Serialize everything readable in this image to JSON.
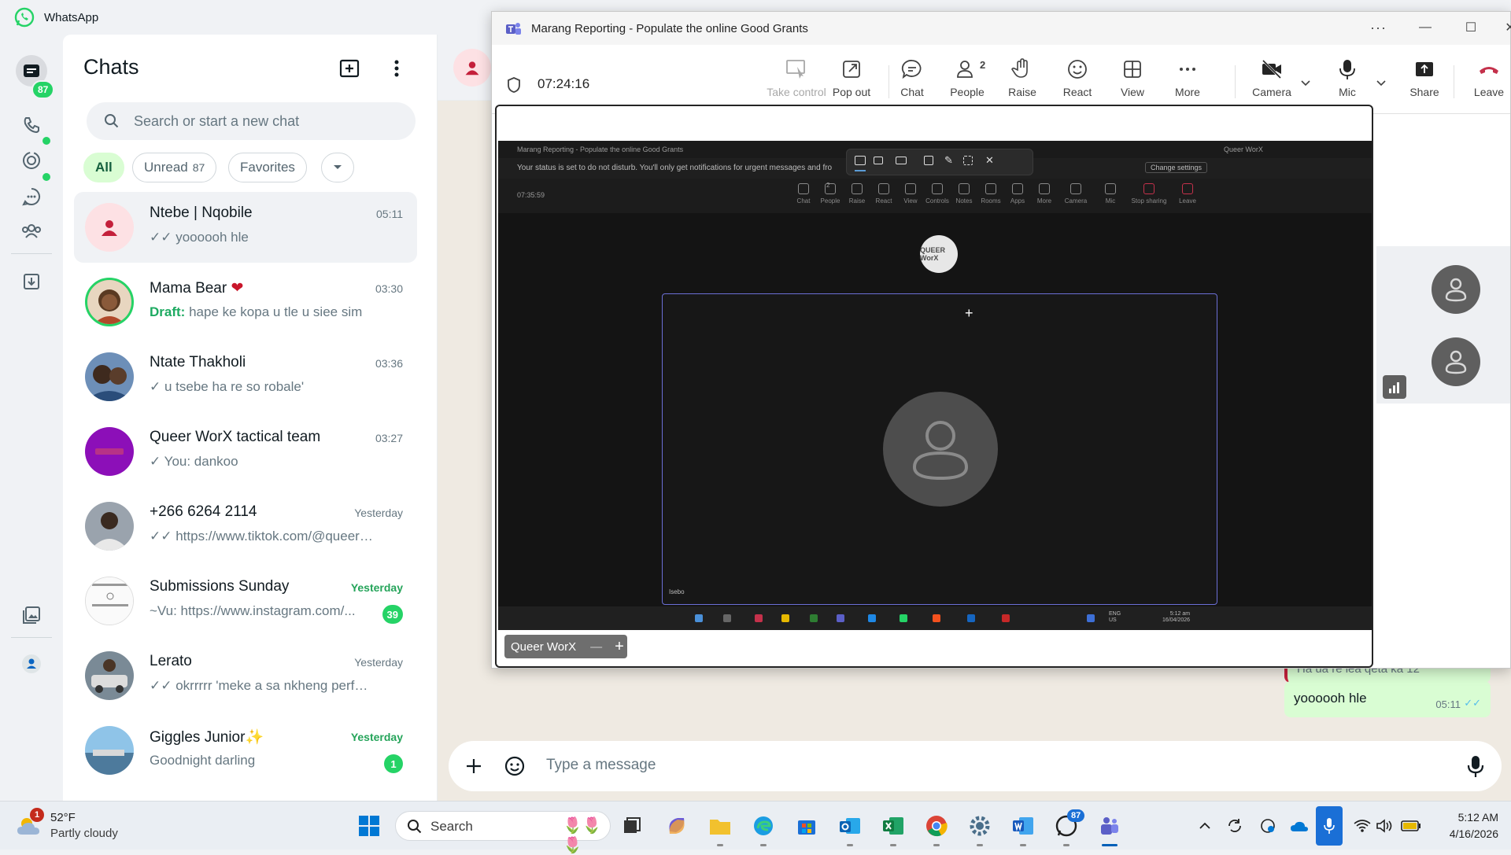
{
  "whatsapp": {
    "app_title": "WhatsApp",
    "rail": {
      "chats_badge": "87"
    },
    "chatlist": {
      "title": "Chats",
      "search_placeholder": "Search or start a new chat",
      "filters": [
        {
          "label": "All",
          "count": ""
        },
        {
          "label": "Unread",
          "count": "87"
        },
        {
          "label": "Favorites",
          "count": ""
        }
      ],
      "chats": [
        {
          "name": "Ntebe | Nqobile",
          "time": "05:11",
          "preview": "yoooooh hle",
          "status": "read",
          "draft_label": "",
          "unread": ""
        },
        {
          "name": "Mama Bear",
          "time": "03:30",
          "preview": "hape ke kopa u tle u siee sim",
          "status": "",
          "draft_label": "Draft:",
          "unread": ""
        },
        {
          "name": "Ntate Thakholi",
          "time": "03:36",
          "preview": "u tsebe ha re so robale'",
          "status": "sent",
          "draft_label": "",
          "unread": ""
        },
        {
          "name": "Queer WorX tactical team",
          "time": "03:27",
          "preview": "You: dankoo",
          "status": "sent",
          "draft_label": "",
          "unread": ""
        },
        {
          "name": "+266 6264 2114",
          "time": "Yesterday",
          "preview": "https://www.tiktok.com/@queer_w...",
          "status": "read",
          "draft_label": "",
          "unread": ""
        },
        {
          "name": "Submissions Sunday",
          "time": "Yesterday",
          "preview": "~Vu: https://www.instagram.com/...",
          "status": "",
          "draft_label": "",
          "unread": "39"
        },
        {
          "name": "Lerato",
          "time": "Yesterday",
          "preview": "okrrrrr 'meke a sa nkheng perfume",
          "status": "read",
          "draft_label": "",
          "unread": ""
        },
        {
          "name": "Giggles Junior",
          "time": "Yesterday",
          "preview": "Goodnight darling",
          "status": "",
          "draft_label": "",
          "unread": "1"
        }
      ]
    },
    "conversation": {
      "partial_bubble_text": "Ha ua re lea qeta ka 12",
      "last_message": "yoooooh hle",
      "last_message_time": "05:11",
      "compose_placeholder": "Type a message"
    }
  },
  "teams": {
    "window_title": "Marang Reporting - Populate the online Good Grants",
    "timer": "07:24:16",
    "toolbar": [
      {
        "label": "Take control",
        "icon": "take-control-icon"
      },
      {
        "label": "Pop out",
        "icon": "pop-out-icon"
      },
      {
        "label": "Chat",
        "icon": "chat-icon"
      },
      {
        "label": "People",
        "icon": "people-icon",
        "count": "2"
      },
      {
        "label": "Raise",
        "icon": "raise-hand-icon"
      },
      {
        "label": "React",
        "icon": "react-icon"
      },
      {
        "label": "View",
        "icon": "view-icon"
      },
      {
        "label": "More",
        "icon": "more-icon"
      },
      {
        "label": "Camera",
        "icon": "camera-off-icon"
      },
      {
        "label": "Mic",
        "icon": "mic-icon"
      },
      {
        "label": "Share",
        "icon": "share-icon"
      },
      {
        "label": "Leave",
        "icon": "leave-icon"
      }
    ],
    "shared_screen": {
      "title": "Marang Reporting - Populate the online Good Grants",
      "status_banner": "Your status is set to do not disturb. You'll only get notifications for urgent messages and fro",
      "change_settings": "Change settings",
      "org_label": "Queer WorX",
      "timer": "07:35:59",
      "tools": [
        "Chat",
        "People",
        "Raise",
        "React",
        "View",
        "Controls",
        "Notes",
        "Rooms",
        "Apps",
        "More",
        "Camera",
        "Mic",
        "Stop sharing",
        "Leave"
      ],
      "people_count": "2",
      "logo_text": "QUEER WorX",
      "participant_name": "Isebo",
      "lang": "ENG",
      "region": "US",
      "time": "5:12 am",
      "date": "16/04/2026"
    },
    "tab_label": "Queer WorX"
  },
  "taskbar": {
    "weather_temp": "52°F",
    "weather_desc": "Partly cloudy",
    "weather_badge": "1",
    "search_label": "Search",
    "whatsapp_badge": "87",
    "time": "5:12 AM",
    "date": "4/16/2026"
  },
  "colors": {
    "wa_green": "#25d366",
    "wa_bubble": "#d9fdd3",
    "teams_purple": "#6b6fd6",
    "leave_red": "#c4314b",
    "win_accent": "#005fb8"
  }
}
